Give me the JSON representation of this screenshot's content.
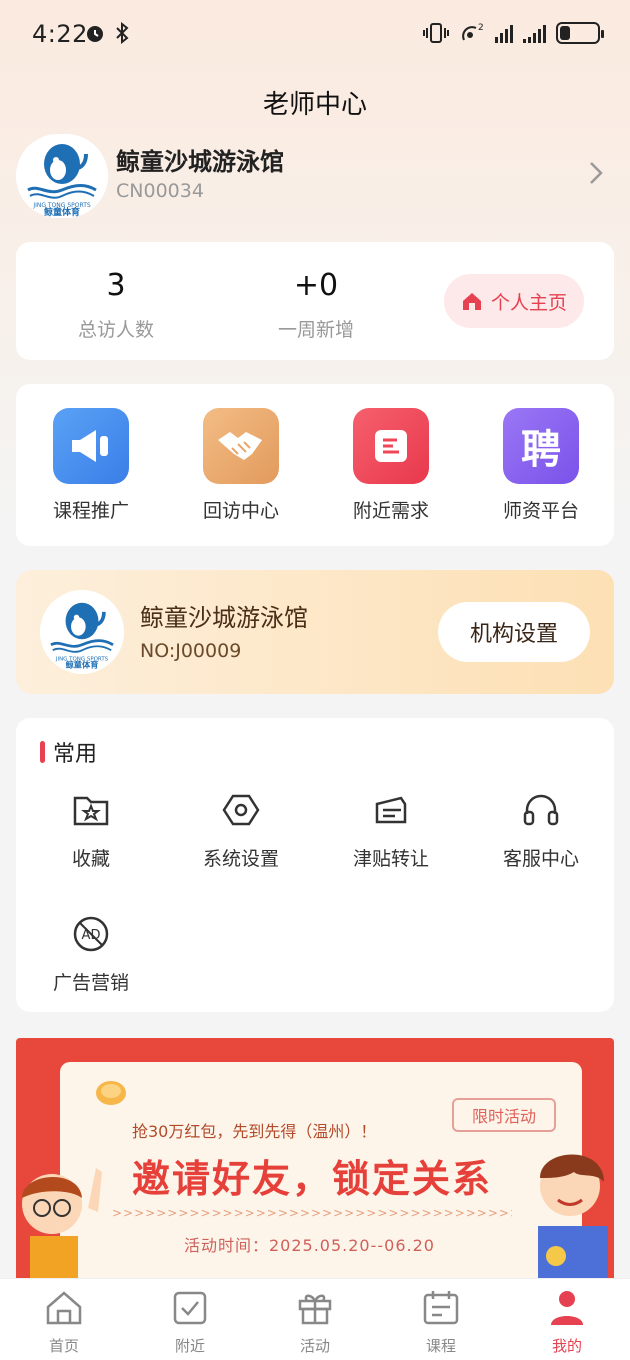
{
  "status_bar": {
    "time": "4:22"
  },
  "header": {
    "title": "老师中心"
  },
  "profile": {
    "name": "鲸童沙城游泳馆",
    "id": "CN00034",
    "logo_text": "鲸童体育",
    "logo_sub": "JING TONG SPORTS"
  },
  "stats": {
    "visitors_value": "3",
    "visitors_label": "总访人数",
    "weekly_value": "+0",
    "weekly_label": "一周新增",
    "home_button": "个人主页"
  },
  "shortcuts": [
    {
      "label": "课程推广",
      "color": "#4a8ff0",
      "icon": "megaphone-icon"
    },
    {
      "label": "回访中心",
      "color": "#e9a76a",
      "icon": "handshake-icon"
    },
    {
      "label": "附近需求",
      "color": "#f0465a",
      "icon": "document-icon"
    },
    {
      "label": "师资平台",
      "color": "#8a63f0",
      "icon_text": "聘",
      "icon": "recruit-icon"
    }
  ],
  "org": {
    "name": "鲸童沙城游泳馆",
    "number": "NO:J00009",
    "settings_button": "机构设置"
  },
  "common": {
    "title": "常用",
    "items": [
      {
        "label": "收藏",
        "icon": "favorite-folder-icon"
      },
      {
        "label": "系统设置",
        "icon": "settings-hexagon-icon"
      },
      {
        "label": "津贴转让",
        "icon": "ticket-icon"
      },
      {
        "label": "客服中心",
        "icon": "headset-icon"
      },
      {
        "label": "广告营销",
        "icon": "ad-icon"
      }
    ]
  },
  "banner": {
    "subtitle": "抢30万红包，先到先得（温州）！",
    "tag": "限时活动",
    "title": "邀请好友，锁定关系",
    "dashes": ">>>>>>>>>>>>>>>>>>>>>>>>>>>>>>>>>>>>>>>>>>>>>>>>>>>>>>>",
    "time": "活动时间：2025.05.20--06.20"
  },
  "tabbar": [
    {
      "label": "首页",
      "icon": "home-icon"
    },
    {
      "label": "附近",
      "icon": "nearby-icon"
    },
    {
      "label": "活动",
      "icon": "gift-icon"
    },
    {
      "label": "课程",
      "icon": "course-icon"
    },
    {
      "label": "我的",
      "icon": "profile-icon",
      "active": true
    }
  ],
  "colors": {
    "accent": "#e64150",
    "orange": "#e8483c"
  }
}
